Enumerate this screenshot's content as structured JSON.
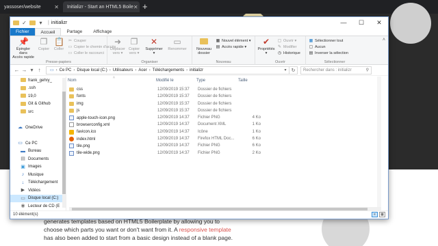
{
  "browser": {
    "tab1": "yassoser/website",
    "tab2": "Initializr - Start an HTML5 Boile",
    "new_tab": "+"
  },
  "page": {
    "line1": "generates templates based on HTML5 Boilerplate by allowing you to",
    "line2": "choose which parts you want or don't want from it. A ",
    "link": "responsive template",
    "line3": "has also been added to start from a basic design instead of a blank page."
  },
  "window": {
    "title": "initializr",
    "controls": {
      "minimize": "—",
      "maximize": "☐",
      "close": "✕"
    },
    "tabs": [
      "Fichier",
      "Accueil",
      "Partage",
      "Affichage"
    ],
    "ribbon": {
      "clipboard": {
        "label": "Presse-papiers",
        "pin": "Épingler dans\nAccès rapide",
        "copy": "Copier",
        "paste": "Coller",
        "cut": "Couper",
        "copy_path": "Copier le chemin d'accès",
        "paste_shortcut": "Coller le raccourci"
      },
      "organize": {
        "label": "Organiser",
        "move_to": "Déplacer\nvers ▾",
        "copy_to": "Copier\nvers ▾",
        "delete": "Supprimer\n▾",
        "rename": "Renommer"
      },
      "new": {
        "label": "Nouveau",
        "new_folder": "Nouveau\ndossier",
        "new_item": "Nouvel élément ▾",
        "quick_access": "Accès rapide ▾"
      },
      "open": {
        "label": "Ouvrir",
        "properties": "Propriétés\n▾",
        "open": "Ouvrir ▾",
        "modify": "Modifier",
        "history": "Historique"
      },
      "select": {
        "label": "Sélectionner",
        "select_all": "Sélectionner tout",
        "select_none": "Aucun",
        "invert": "Inverser la sélection"
      }
    },
    "address": {
      "crumbs": [
        "Ce PC",
        "Disque local (C:)",
        "Utilisateurs",
        "Acer",
        "Téléchargements",
        "initializr"
      ],
      "search_placeholder": "Rechercher dans : initializr"
    },
    "nav": [
      {
        "label": "frank_gehry_",
        "icon": "folder"
      },
      {
        "label": ".ssh",
        "icon": "folder"
      },
      {
        "label": "19,0",
        "icon": "folder"
      },
      {
        "label": "Git & Github",
        "icon": "folder"
      },
      {
        "label": "src",
        "icon": "folder"
      },
      {
        "label": "",
        "icon": ""
      },
      {
        "label": "OneDrive",
        "icon": "cloud"
      },
      {
        "label": "",
        "icon": ""
      },
      {
        "label": "Ce PC",
        "icon": "pc"
      },
      {
        "label": "Bureau",
        "icon": "desktop"
      },
      {
        "label": "Documents",
        "icon": "documents"
      },
      {
        "label": "Images",
        "icon": "images"
      },
      {
        "label": "Musique",
        "icon": "music"
      },
      {
        "label": "Téléchargement",
        "icon": "download"
      },
      {
        "label": "Vidéos",
        "icon": "videos"
      },
      {
        "label": "Disque local (C:)",
        "icon": "drive"
      },
      {
        "label": "Lecteur de CD (E",
        "icon": "cd"
      }
    ],
    "columns": {
      "name": "Nom",
      "date": "Modifié le",
      "type": "Type",
      "size": "Taille"
    },
    "files": [
      {
        "name": "css",
        "date": "12/09/2019 15:37",
        "type": "Dossier de fichiers",
        "size": "",
        "kind": "folder"
      },
      {
        "name": "fonts",
        "date": "12/09/2019 15:37",
        "type": "Dossier de fichiers",
        "size": "",
        "kind": "folder"
      },
      {
        "name": "img",
        "date": "12/09/2019 15:37",
        "type": "Dossier de fichiers",
        "size": "",
        "kind": "folder"
      },
      {
        "name": "js",
        "date": "12/09/2019 15:37",
        "type": "Dossier de fichiers",
        "size": "",
        "kind": "folder"
      },
      {
        "name": "apple-touch-icon.png",
        "date": "12/09/2019 14:37",
        "type": "Fichier PNG",
        "size": "4 Ko",
        "kind": "png"
      },
      {
        "name": "browserconfig.xml",
        "date": "12/09/2019 14:37",
        "type": "Document XML",
        "size": "1 Ko",
        "kind": "xml"
      },
      {
        "name": "favicon.ico",
        "date": "12/09/2019 14:37",
        "type": "Icône",
        "size": "1 Ko",
        "kind": "ico"
      },
      {
        "name": "index.html",
        "date": "12/09/2019 14:37",
        "type": "Firefox HTML Doc...",
        "size": "6 Ko",
        "kind": "html"
      },
      {
        "name": "tile.png",
        "date": "12/09/2019 14:37",
        "type": "Fichier PNG",
        "size": "6 Ko",
        "kind": "png"
      },
      {
        "name": "tile-wide.png",
        "date": "12/09/2019 14:37",
        "type": "Fichier PNG",
        "size": "2 Ko",
        "kind": "png"
      }
    ],
    "status": "10 élément(s)",
    "colors": {
      "accent": "#1979ca",
      "folder": "#e9c15a",
      "selection": "#cce8ff"
    }
  }
}
